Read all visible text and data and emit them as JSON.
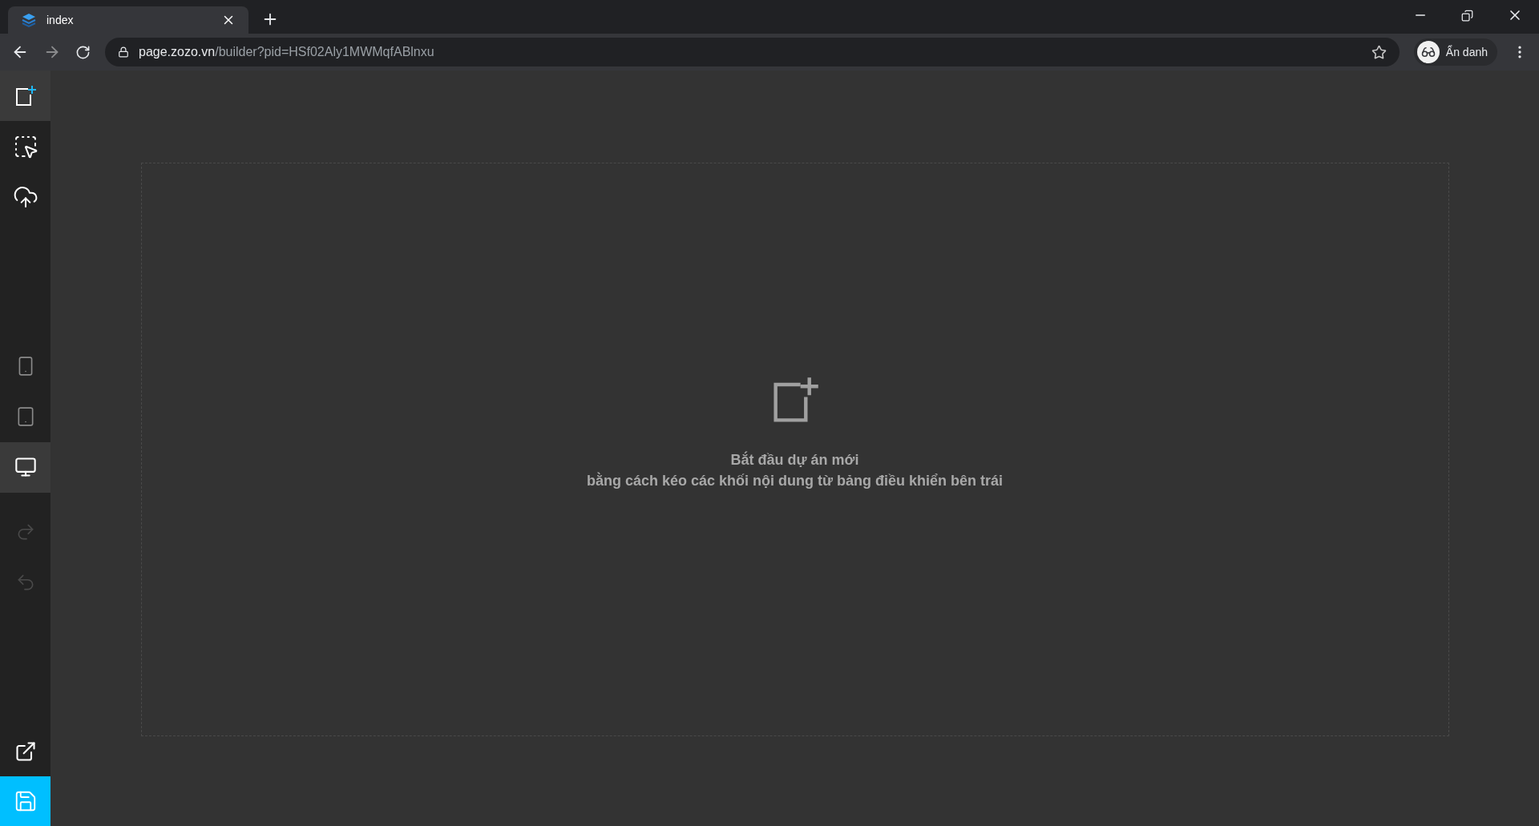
{
  "browser": {
    "tab": {
      "title": "index",
      "selected": true
    },
    "url": {
      "host": "page.zozo.vn",
      "path": "/builder?pid=HSf02Aly1MWMqfABlnxu"
    },
    "profile": {
      "label": "Ẩn danh"
    }
  },
  "sidebar": {
    "tools": [
      {
        "kind": "add-block",
        "selected": true
      },
      {
        "kind": "select",
        "selected": false
      },
      {
        "kind": "upload",
        "selected": false
      }
    ],
    "devices": [
      {
        "kind": "mobile",
        "selected": false
      },
      {
        "kind": "tablet",
        "selected": false
      },
      {
        "kind": "desktop",
        "selected": true
      }
    ],
    "history": [
      {
        "kind": "redo",
        "disabled": true
      },
      {
        "kind": "undo",
        "disabled": true
      }
    ],
    "actions": [
      {
        "kind": "export",
        "highlighted": false
      },
      {
        "kind": "save",
        "highlighted": true
      }
    ]
  },
  "canvas": {
    "message": [
      "Bắt đầu dự án mới",
      "bằng cách kéo các khối nội dung từ bảng điều khiển bên trái"
    ]
  }
}
